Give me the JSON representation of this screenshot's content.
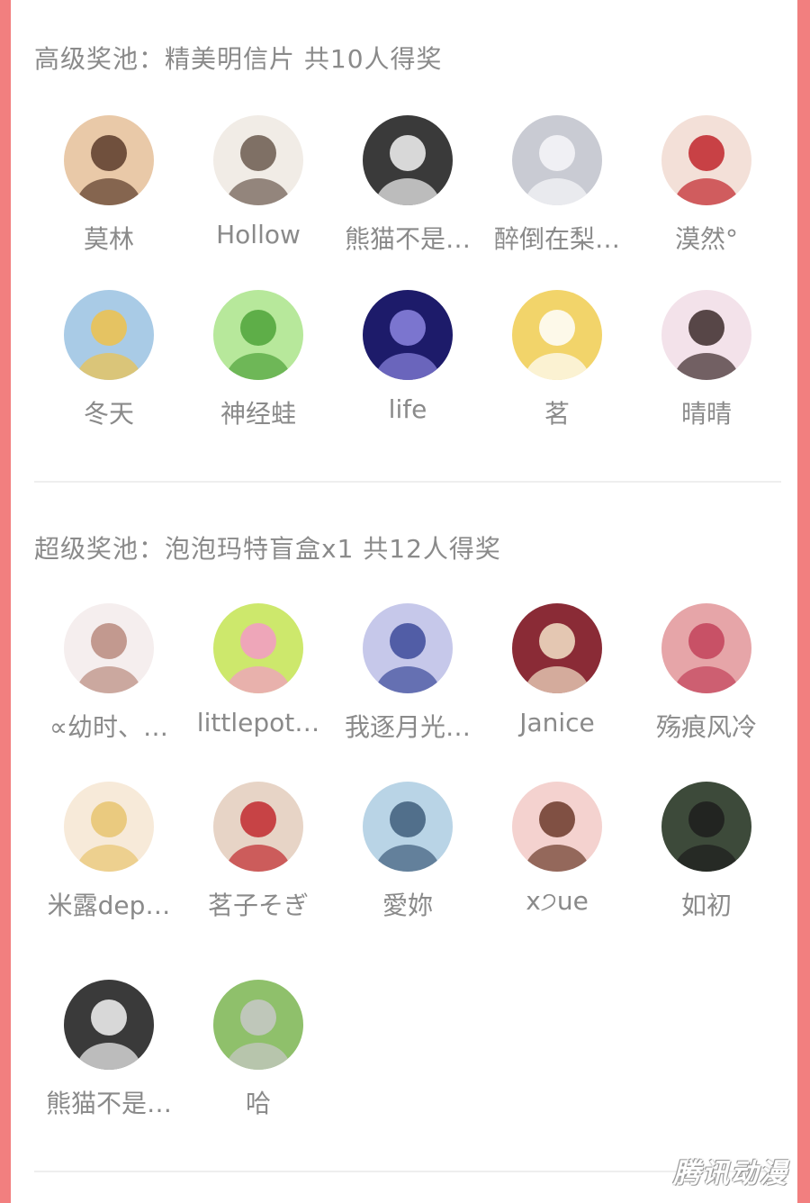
{
  "sections": [
    {
      "title": "高级奖池：精美明信片 共10人得奖",
      "winners": [
        {
          "name": "莫林",
          "avatar": "anime-girl-brown-hair",
          "bg": "#e9c9a8",
          "fg": "#5a3b2a"
        },
        {
          "name": "Hollow",
          "avatar": "sketch-boy",
          "bg": "#f1ece6",
          "fg": "#6b5a4e"
        },
        {
          "name": "熊猫不是…",
          "avatar": "panda-photo",
          "bg": "#3a3a3a",
          "fg": "#f4f4f4"
        },
        {
          "name": "醉倒在梨…",
          "avatar": "white-hair-character",
          "bg": "#c9cbd3",
          "fg": "#f7f7f9"
        },
        {
          "name": "漠然°",
          "avatar": "girl-red-dress",
          "bg": "#f3e0d8",
          "fg": "#c0242b"
        }
      ]
    },
    {
      "title": "",
      "winners": [
        {
          "name": "冬天",
          "avatar": "anime-girl-blonde",
          "bg": "#a9cbe6",
          "fg": "#f0c24a"
        },
        {
          "name": "神经蛙",
          "avatar": "green-frog",
          "bg": "#b7e89b",
          "fg": "#4fa33a"
        },
        {
          "name": "life",
          "avatar": "starry-night",
          "bg": "#1d1b6a",
          "fg": "#8c85e0"
        },
        {
          "name": "茗",
          "avatar": "cartoon-pikachu",
          "bg": "#f2d46a",
          "fg": "#ffffff"
        },
        {
          "name": "晴晴",
          "avatar": "girl-bunny-ears",
          "bg": "#f3e2ea",
          "fg": "#3b2a2a"
        }
      ]
    },
    {
      "title": "超级奖池：泡泡玛特盲盒x1 共12人得奖",
      "winners": [
        {
          "name": "∝幼时、…",
          "avatar": "anime-long-hair",
          "bg": "#f5eeee",
          "fg": "#b98a7e"
        },
        {
          "name": "littlepot…",
          "avatar": "pink-hair-chibi",
          "bg": "#cde86c",
          "fg": "#f39ac7"
        },
        {
          "name": "我逐月光…",
          "avatar": "girl-seaside",
          "bg": "#c6c8ea",
          "fg": "#3c4a9a"
        },
        {
          "name": "Janice",
          "avatar": "guinea-pig",
          "bg": "#8a2b36",
          "fg": "#f3e3c8"
        },
        {
          "name": "殇痕风冷",
          "avatar": "red-hair-anime",
          "bg": "#e6a5a8",
          "fg": "#c2425a"
        }
      ]
    },
    {
      "title": "",
      "winners": [
        {
          "name": "米露dep…",
          "avatar": "blonde-anime-crying",
          "bg": "#f7ead9",
          "fg": "#e8c46f"
        },
        {
          "name": "茗子そぎ",
          "avatar": "red-anime-sketch",
          "bg": "#e7d4c6",
          "fg": "#c1292e"
        },
        {
          "name": "愛妳",
          "avatar": "blue-anime-girl",
          "bg": "#b9d4e6",
          "fg": "#3e5d7a"
        },
        {
          "name": "x੭ue",
          "avatar": "cartoon-girl-curly",
          "bg": "#f4d2cf",
          "fg": "#6b3a2a"
        },
        {
          "name": "如初",
          "avatar": "man-sunglasses",
          "bg": "#3d4a3a",
          "fg": "#1d1d1d"
        }
      ]
    },
    {
      "title": "",
      "winners": [
        {
          "name": "熊猫不是…",
          "avatar": "panda-photo",
          "bg": "#3a3a3a",
          "fg": "#f4f4f4"
        },
        {
          "name": "哈",
          "avatar": "husky-puppies",
          "bg": "#8fc06b",
          "fg": "#c8c8c8"
        }
      ]
    }
  ],
  "watermark": "腾讯动漫"
}
